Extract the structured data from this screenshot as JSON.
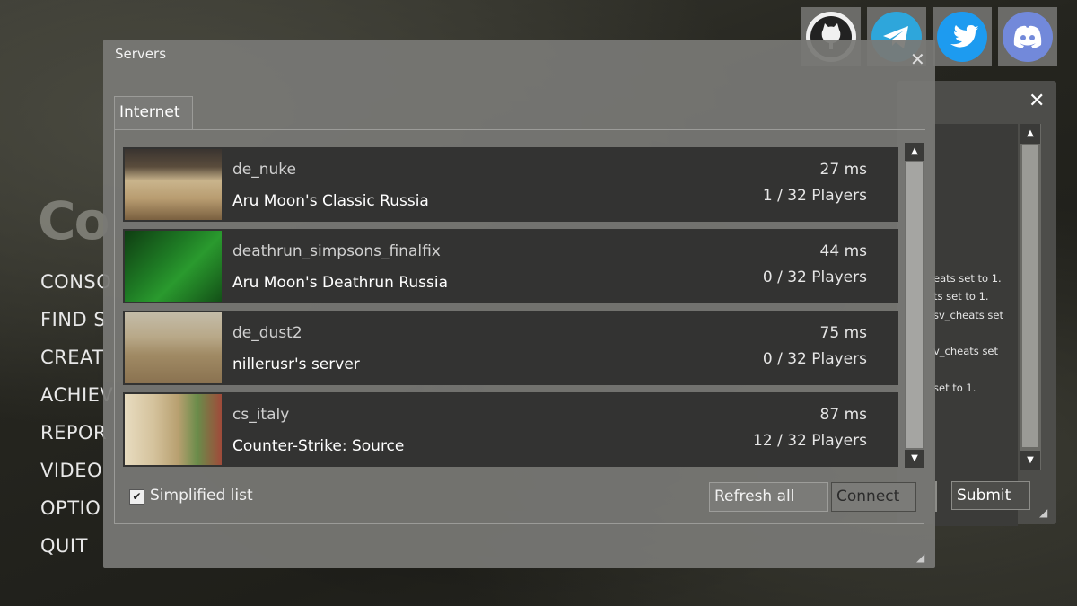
{
  "menu": {
    "logo": "Co",
    "items": [
      "CONSO",
      "FIND S",
      "CREAT",
      "ACHIEV",
      "REPOR",
      "VIDEO",
      "OPTIO",
      "QUIT"
    ]
  },
  "social": [
    {
      "name": "github",
      "icon": "github-icon",
      "color": "#f0f0f0"
    },
    {
      "name": "telegram",
      "icon": "telegram-icon",
      "color": "#2ea6db"
    },
    {
      "name": "twitter",
      "icon": "twitter-icon",
      "color": "#1d9bf0"
    },
    {
      "name": "discord",
      "icon": "discord-icon",
      "color": "#7289da"
    }
  ],
  "console": {
    "close": "✕",
    "log": [
      "eats set to 1.",
      "ts set to 1.",
      "sv_cheats set",
      "v_cheats set",
      "set to 1."
    ],
    "submit_label": "Submit"
  },
  "servers_window": {
    "title": "Servers",
    "close": "✕",
    "tab": "Internet",
    "rows": [
      {
        "map": "de_nuke",
        "name": "Aru Moon's Classic Russia",
        "ping": "27 ms",
        "players": "1 / 32 Players"
      },
      {
        "map": "deathrun_simpsons_finalfix",
        "name": "Aru Moon's Deathrun Russia",
        "ping": "44 ms",
        "players": "0 / 32 Players"
      },
      {
        "map": "de_dust2",
        "name": "nillerusr's server",
        "ping": "75 ms",
        "players": "0 / 32 Players"
      },
      {
        "map": "cs_italy",
        "name": "Counter-Strike: Source",
        "ping": "87 ms",
        "players": "12 / 32 Players"
      }
    ],
    "simplified_label": "Simplified list",
    "simplified_checked": true,
    "refresh_label": "Refresh all",
    "connect_label": "Connect"
  }
}
